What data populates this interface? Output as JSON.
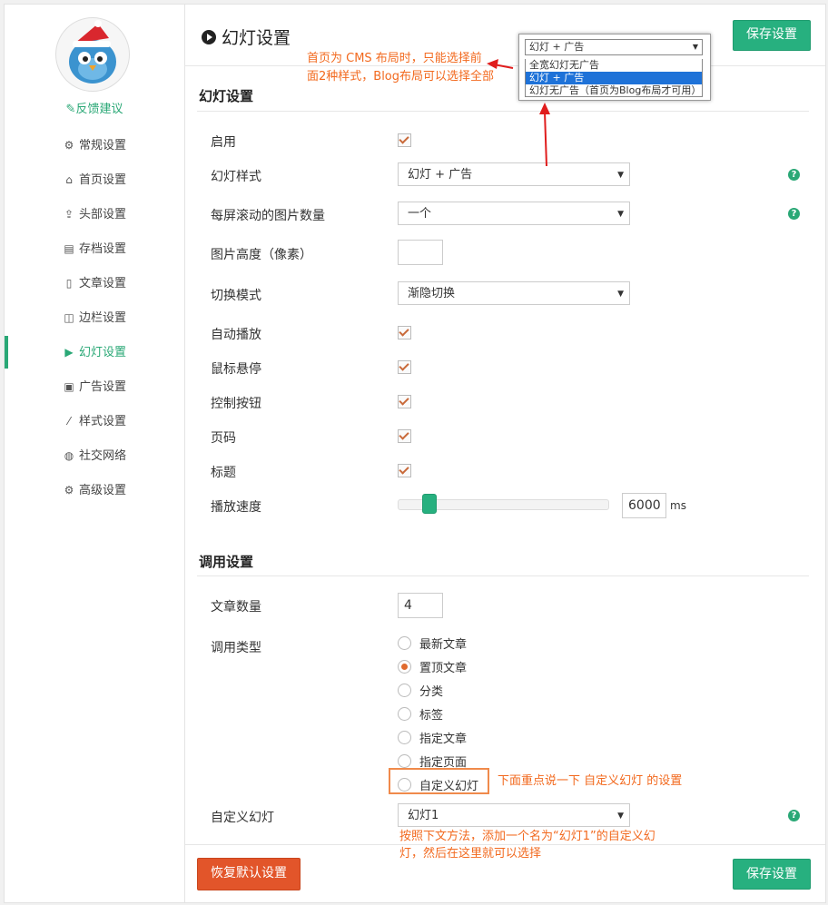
{
  "sidebar": {
    "feedback": "✎反馈建议",
    "items": [
      {
        "icon": "gear-icon",
        "glyph": "⚙",
        "label": "常规设置"
      },
      {
        "icon": "home-icon",
        "glyph": "⌂",
        "label": "首页设置"
      },
      {
        "icon": "upload-icon",
        "glyph": "⇪",
        "label": "头部设置"
      },
      {
        "icon": "book-icon",
        "glyph": "▤",
        "label": "存档设置"
      },
      {
        "icon": "file-icon",
        "glyph": "▯",
        "label": "文章设置"
      },
      {
        "icon": "columns-icon",
        "glyph": "◫",
        "label": "边栏设置"
      },
      {
        "icon": "play-circle-icon",
        "glyph": "▶",
        "label": "幻灯设置"
      },
      {
        "icon": "gift-icon",
        "glyph": "▣",
        "label": "广告设置"
      },
      {
        "icon": "magic-wand-icon",
        "glyph": "⁄",
        "label": "样式设置"
      },
      {
        "icon": "globe-icon",
        "glyph": "◍",
        "label": "社交网络"
      },
      {
        "icon": "cogs-icon",
        "glyph": "⚙",
        "label": "高级设置"
      }
    ]
  },
  "header": {
    "title": "幻灯设置",
    "save_label": "保存设置"
  },
  "popup": {
    "selected": "幻灯 + 广告",
    "options": [
      "全宽幻灯无广告",
      "幻灯 + 广告",
      "幻灯无广告（首页为Blog布局才可用）"
    ]
  },
  "annotations": {
    "cms_note_1": "首页为 CMS 布局时，只能选择前",
    "cms_note_2": "面2种样式，Blog布局可以选择全部",
    "custom_note": "下面重点说一下 自定义幻灯 的设置",
    "slide_note_1": "按照下文方法，添加一个名为“幻灯1”的自定义幻",
    "slide_note_2": "灯，然后在这里就可以选择"
  },
  "slider_section": {
    "heading": "幻灯设置",
    "enable": "启用",
    "style_label": "幻灯样式",
    "style_value": "幻灯 + 广告",
    "count_label": "每屏滚动的图片数量",
    "count_value": "一个",
    "height_label": "图片高度（像素）",
    "mode_label": "切换模式",
    "mode_value": "渐隐切换",
    "autoplay": "自动播放",
    "hover_pause": "鼠标悬停",
    "controls": "控制按钮",
    "pager": "页码",
    "caption": "标题",
    "speed_label": "播放速度",
    "speed_value": "6000",
    "speed_unit": "ms"
  },
  "call_section": {
    "heading": "调用设置",
    "count_label": "文章数量",
    "count_value": "4",
    "type_label": "调用类型",
    "types": [
      "最新文章",
      "置顶文章",
      "分类",
      "标签",
      "指定文章",
      "指定页面",
      "自定义幻灯"
    ],
    "selected_type": "置顶文章",
    "custom_label": "自定义幻灯",
    "custom_value": "幻灯1"
  },
  "footer": {
    "reset_label": "恢复默认设置",
    "save_label": "保存设置"
  },
  "colors": {
    "accent": "#27b07f",
    "danger": "#e2552a",
    "annotation": "#f2691e"
  }
}
